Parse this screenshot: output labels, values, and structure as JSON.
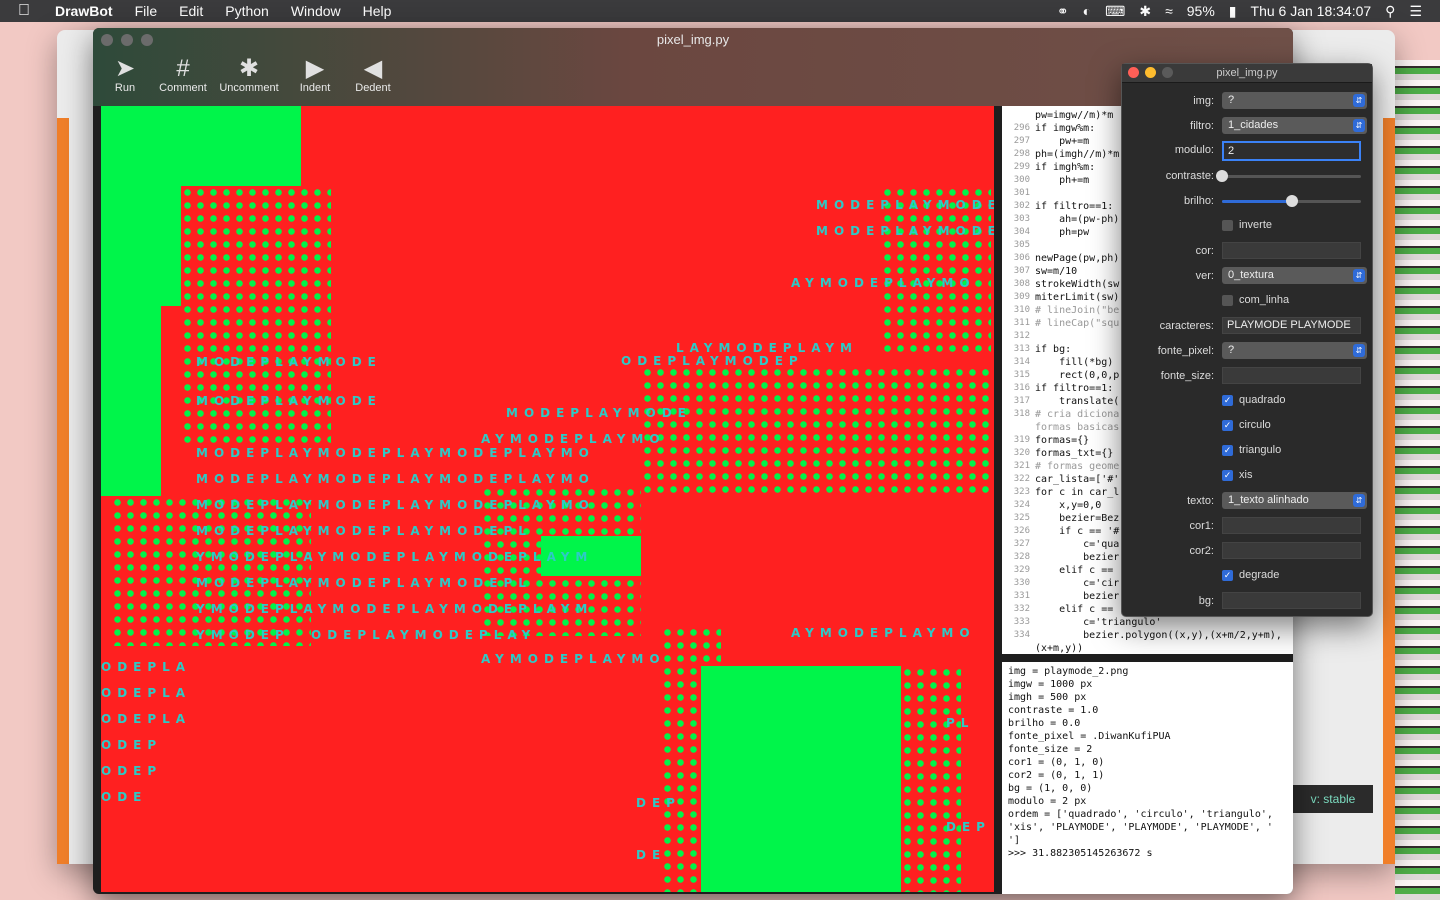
{
  "menubar": {
    "app": "DrawBot",
    "items": [
      "File",
      "Edit",
      "Python",
      "Window",
      "Help"
    ],
    "battery": "95%",
    "datetime": "Thu 6 Jan  18:34:07"
  },
  "window": {
    "title": "pixel_img.py",
    "toolbar": [
      {
        "label": "Run",
        "icon": "play-icon"
      },
      {
        "label": "Comment",
        "icon": "hash-icon"
      },
      {
        "label": "Uncomment",
        "icon": "hash-broken-icon"
      },
      {
        "label": "Indent",
        "icon": "indent-icon"
      },
      {
        "label": "Dedent",
        "icon": "dedent-icon"
      }
    ]
  },
  "canvas": {
    "text_rows": [
      "MODEPLAYMODE",
      "AYMODEPLAYMO",
      "ODEPLAYMODEP",
      "LAYMODEPLAYM",
      "MODEPLAYMODEPLAYMODEPLAYMO",
      "YMODEPLAYMODEPLAYMODEPLAYM",
      "MODEPLAYMODEPLAYMODEPL",
      "YMODEP",
      "ODEPLAYMODEPLAY",
      "AYMODEPLAYMO",
      "ODEPLA",
      "ODEP",
      "ODE",
      "DEP",
      "DE",
      "PL"
    ]
  },
  "editor": {
    "lines": [
      {
        "n": "",
        "code": "pw=imgw//m)*m"
      },
      {
        "n": "296",
        "code": "if imgw%m:"
      },
      {
        "n": "297",
        "code": "    pw+=m"
      },
      {
        "n": "298",
        "code": "ph=(imgh//m)*m"
      },
      {
        "n": "299",
        "code": "if imgh%m:"
      },
      {
        "n": "300",
        "code": "    ph+=m"
      },
      {
        "n": "301",
        "code": ""
      },
      {
        "n": "302",
        "code": "if filtro==1:"
      },
      {
        "n": "303",
        "code": "    ah=(pw-ph)"
      },
      {
        "n": "304",
        "code": "    ph=pw"
      },
      {
        "n": "305",
        "code": ""
      },
      {
        "n": "306",
        "code": "newPage(pw,ph)"
      },
      {
        "n": "307",
        "code": "sw=m/10"
      },
      {
        "n": "308",
        "code": "strokeWidth(sw"
      },
      {
        "n": "309",
        "code": "miterLimit(sw)"
      },
      {
        "n": "310",
        "code": "# lineJoin(\"be"
      },
      {
        "n": "311",
        "code": "# lineCap(\"squ"
      },
      {
        "n": "312",
        "code": ""
      },
      {
        "n": "313",
        "code": "if bg:"
      },
      {
        "n": "314",
        "code": "    fill(*bg)"
      },
      {
        "n": "315",
        "code": "    rect(0,0,p"
      },
      {
        "n": "316",
        "code": "if filtro==1:"
      },
      {
        "n": "317",
        "code": "    translate("
      },
      {
        "n": "318",
        "code": "# cria diciona"
      },
      {
        "n": "",
        "code": "formas basicas"
      },
      {
        "n": "319",
        "code": "formas={}"
      },
      {
        "n": "320",
        "code": "formas_txt={}"
      },
      {
        "n": "321",
        "code": "# formas geome"
      },
      {
        "n": "322",
        "code": "car_lista=['#'"
      },
      {
        "n": "323",
        "code": "for c in car_l"
      },
      {
        "n": "324",
        "code": "    x,y=0,0"
      },
      {
        "n": "325",
        "code": "    bezier=Bez"
      },
      {
        "n": "326",
        "code": "    if c == '#"
      },
      {
        "n": "327",
        "code": "        c='qua"
      },
      {
        "n": "328",
        "code": "        bezier"
      },
      {
        "n": "329",
        "code": "    elif c =="
      },
      {
        "n": "330",
        "code": "        c='cir"
      },
      {
        "n": "331",
        "code": "        bezier"
      },
      {
        "n": "332",
        "code": "    elif c =="
      },
      {
        "n": "333",
        "code": "        c='triangulo'"
      },
      {
        "n": "334",
        "code": "        bezier.polygon((x,y),(x+m/2,y+m),"
      },
      {
        "n": "",
        "code": "(x+m,y))"
      }
    ]
  },
  "output": {
    "lines": [
      "img = playmode_2.png",
      "imgw = 1000 px",
      "imgh = 500 px",
      "contraste = 1.0",
      "brilho = 0.0",
      "fonte_pixel = .DiwanKufiPUA",
      "fonte_size = 2",
      "cor1 = (0, 1, 0)",
      "cor2 = (0, 1, 1)",
      "bg = (1, 0, 0)",
      "modulo = 2 px",
      "ordem = ['quadrado', 'circulo', 'triangulo',",
      "'xis', 'PLAYMODE', 'PLAYMODE', 'PLAYMODE', '",
      "']",
      ">>> 31.882305145263672 s"
    ]
  },
  "panel": {
    "title": "pixel_img.py",
    "img": {
      "label": "img:",
      "value": "?"
    },
    "filtro": {
      "label": "filtro:",
      "value": "1_cidades"
    },
    "modulo": {
      "label": "modulo:",
      "value": "2"
    },
    "contraste": {
      "label": "contraste:",
      "level": 0.0
    },
    "brilho": {
      "label": "brilho:",
      "level": 0.5
    },
    "inverte": {
      "label": "inverte",
      "checked": false
    },
    "cor": {
      "label": "cor:",
      "value": ""
    },
    "ver": {
      "label": "ver:",
      "value": "0_textura"
    },
    "com_linha": {
      "label": "com_linha",
      "checked": false
    },
    "caracteres": {
      "label": "caracteres:",
      "value": "PLAYMODE PLAYMODE"
    },
    "fonte_pixel": {
      "label": "fonte_pixel:",
      "value": "?"
    },
    "fonte_size": {
      "label": "fonte_size:",
      "value": ""
    },
    "quadrado": {
      "label": "quadrado",
      "checked": true
    },
    "circulo": {
      "label": "circulo",
      "checked": true
    },
    "triangulo": {
      "label": "triangulo",
      "checked": true
    },
    "xis": {
      "label": "xis",
      "checked": true
    },
    "texto": {
      "label": "texto:",
      "value": "1_texto alinhado"
    },
    "cor1": {
      "label": "cor1:",
      "value": ""
    },
    "cor2": {
      "label": "cor2:",
      "value": ""
    },
    "degrade": {
      "label": "degrade",
      "checked": true
    },
    "bg": {
      "label": "bg:",
      "value": ""
    }
  },
  "background_window": {
    "badge": "v: stable"
  },
  "colors": {
    "canvas_bg": "#ff2020",
    "canvas_green": "#00f54a",
    "canvas_text": "#2ec9c6",
    "accent": "#2f6bd8"
  }
}
